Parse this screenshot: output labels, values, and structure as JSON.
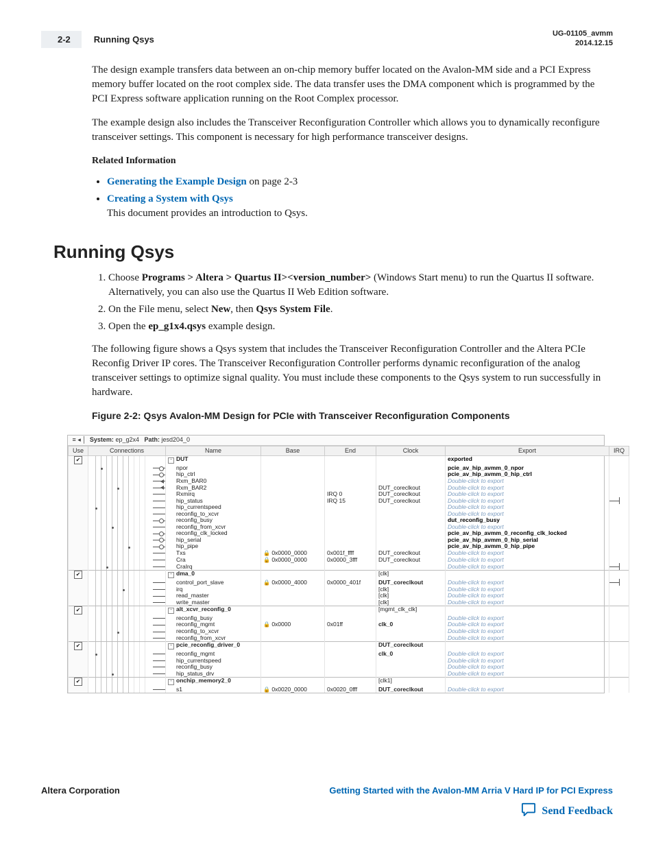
{
  "header": {
    "page_num": "2-2",
    "running_title": "Running Qsys",
    "doc_id": "UG-01105_avmm",
    "doc_date": "2014.12.15"
  },
  "intro": {
    "p1": "The design example transfers data between an on‐chip memory buffer located on the Avalon-MM side and a PCI Express memory buffer located on the root complex side. The data transfer uses the DMA component which is programmed by the PCI Express software application running on the Root Complex processor.",
    "p2": "The example design also includes the Transceiver Reconfiguration Controller which allows you to dynamically reconfigure transceiver settings. This component is necessary for high performance transceiver designs.",
    "rel_hd": "Related Information",
    "rel1_link": "Generating the Example Design",
    "rel1_rest": " on page 2-3",
    "rel2_link": "Creating a System with Qsys",
    "rel2_desc": "This document provides an introduction to Qsys."
  },
  "section": {
    "heading": "Running Qsys",
    "step1_a": "Choose ",
    "step1_b": "Programs > Altera > Quartus II><version_number>",
    "step1_c": " (Windows Start menu) to run the Quartus II software. Alternatively, you can also use the Quartus II Web Edition software.",
    "step2_a": "On the File menu, select ",
    "step2_b": "New",
    "step2_c": ", then ",
    "step2_d": "Qsys System File",
    "step2_e": ".",
    "step3_a": "Open the ",
    "step3_b": "ep_g1x4.qsys",
    "step3_c": " example design.",
    "para": "The following figure shows a Qsys system that includes the Transceiver Reconfiguration Controller and the Altera PCIe Reconfig Driver IP cores. The Transceiver Reconfiguration Controller performs dynamic reconfiguration of the analog transceiver settings to optimize signal quality. You must include these components to the Qsys system to run successfully in hardware.",
    "fig_caption": "Figure 2-2: Qsys Avalon-MM Design for PCIe with Transceiver Reconfiguration Components"
  },
  "figure": {
    "path_label_sys": "System:",
    "path_sys": "ep_g2x4",
    "path_label_p": "Path:",
    "path_p": "jesd204_0",
    "headers": {
      "use": "Use",
      "conn": "Connections",
      "name": "Name",
      "base": "Base",
      "end": "End",
      "clock": "Clock",
      "export": "Export",
      "irq": "IRQ"
    },
    "dbl": "Double-click to export",
    "rows": [
      {
        "grp": true,
        "use": "v",
        "name": "DUT",
        "box": "-",
        "clock": "",
        "export_b": "exported"
      },
      {
        "conn": "o",
        "name": "npor",
        "export_b": "pcie_av_hip_avmm_0_npor"
      },
      {
        "conn": "o",
        "name": "hip_ctrl",
        "export_b": "pcie_av_hip_avmm_0_hip_ctrl"
      },
      {
        "conn": "<",
        "name": "Rxm_BAR0",
        "export_i": true
      },
      {
        "conn": "<",
        "name": "Rxm_BAR2",
        "clock": "DUT_coreclkout",
        "export_i": true
      },
      {
        "name": "Rxmirq",
        "end": "IRQ 0",
        "clock": "DUT_coreclkout",
        "export_i": true
      },
      {
        "name": "hip_status",
        "base": "",
        "end": "IRQ 15",
        "clock": "DUT_coreclkout",
        "export_i": true,
        "irq": true
      },
      {
        "name": "hip_currentspeed",
        "export_i": true
      },
      {
        "name": "reconfig_to_xcvr",
        "export_i": true
      },
      {
        "conn": "o",
        "name": "reconfig_busy",
        "export_b": "dut_reconfig_busy"
      },
      {
        "name": "reconfig_from_xcvr",
        "export_i": true
      },
      {
        "conn": "o",
        "name": "reconfig_clk_locked",
        "export_b": "pcie_av_hip_avmm_0_reconfig_clk_locked"
      },
      {
        "conn": "o",
        "name": "hip_serial",
        "export_b": "pcie_av_hip_avmm_0_hip_serial"
      },
      {
        "conn": "o",
        "name": "hip_pipe",
        "export_b": "pcie_av_hip_avmm_0_hip_pipe"
      },
      {
        "name": "Txs",
        "base": "0x0000_0000",
        "end": "0x001f_ffff",
        "clock": "DUT_coreclkout",
        "lock": true,
        "export_i": true
      },
      {
        "name": "Cra",
        "base": "0x0000_0000",
        "end": "0x0000_3fff",
        "clock": "DUT_coreclkout",
        "lock": true,
        "export_i": true
      },
      {
        "name": "CraIrq",
        "export_i": true,
        "irq": true
      },
      {
        "grp": true,
        "use": "v",
        "name": "dma_0",
        "box": "-",
        "clock": "[clk]"
      },
      {
        "name": "control_port_slave",
        "base": "0x0000_4000",
        "end": "0x0000_401f",
        "clock_b": "DUT_coreclkout",
        "lock": true,
        "export_i": true,
        "irq": true
      },
      {
        "name": "irq",
        "clock": "[clk]",
        "export_i": true
      },
      {
        "name": "read_master",
        "clock": "[clk]",
        "export_i": true
      },
      {
        "name": "write_master",
        "clock": "[clk]",
        "export_i": true
      },
      {
        "grp": true,
        "use": "v",
        "name": "alt_xcvr_reconfig_0",
        "box": "-",
        "clock": "[mgmt_clk_clk]"
      },
      {
        "name": "reconfig_busy",
        "export_i": true
      },
      {
        "name": "reconfig_mgmt",
        "base": "0x0000",
        "end": "0x01ff",
        "clock_b": "clk_0",
        "lock": true,
        "export_i": true
      },
      {
        "name": "reconfig_to_xcvr",
        "export_i": true
      },
      {
        "name": "reconfig_from_xcvr",
        "export_i": true
      },
      {
        "grp": true,
        "use": "v",
        "name": "pcie_reconfig_driver_0",
        "box": "-",
        "clock_b": "DUT_coreclkout"
      },
      {
        "name": "reconfig_mgmt",
        "clock_b": "clk_0",
        "export_i": true
      },
      {
        "name": "hip_currentspeed",
        "export_i": true
      },
      {
        "name": "reconfig_busy",
        "export_i": true
      },
      {
        "name": "hip_status_drv",
        "export_i": true
      },
      {
        "grp": true,
        "use": "v",
        "name": "onchip_memory2_0",
        "box": "-",
        "clock": "[clk1]"
      },
      {
        "name": "s1",
        "base": "0x0020_0000",
        "end": "0x0020_0fff",
        "clock_b": "DUT_coreclkout",
        "lock": true,
        "export_i": true
      }
    ]
  },
  "footer": {
    "corp": "Altera Corporation",
    "guide_link": "Getting Started with the Avalon-MM Arria V Hard IP for PCI Express",
    "feedback": "Send Feedback"
  }
}
